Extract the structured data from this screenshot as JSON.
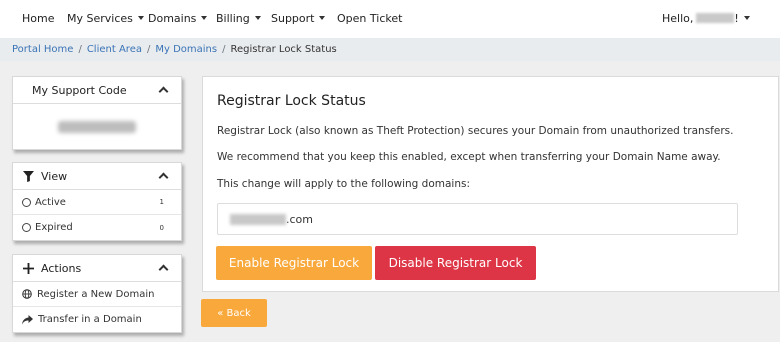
{
  "nav": {
    "items": [
      {
        "label": "Home"
      },
      {
        "label": "My Services"
      },
      {
        "label": "Domains"
      },
      {
        "label": "Billing"
      },
      {
        "label": "Support"
      },
      {
        "label": "Open Ticket"
      }
    ],
    "hello_prefix": "Hello,",
    "hello_suffix": "!"
  },
  "breadcrumb": {
    "items": [
      "Portal Home",
      "Client Area",
      "My Domains"
    ],
    "active": "Registrar Lock Status"
  },
  "sidebar": {
    "support_code": {
      "title": "My Support Code"
    },
    "view": {
      "title": "View",
      "icon": "filter-icon",
      "items": [
        {
          "label": "Active",
          "count": "1"
        },
        {
          "label": "Expired",
          "count": "0"
        }
      ]
    },
    "actions": {
      "title": "Actions",
      "icon": "plus-icon",
      "items": [
        {
          "label": "Register a New Domain",
          "icon": "globe-icon"
        },
        {
          "label": "Transfer in a Domain",
          "icon": "share-arrow-icon"
        }
      ]
    }
  },
  "main": {
    "title": "Registrar Lock Status",
    "description": "Registrar Lock (also known as Theft Protection) secures your Domain from unauthorized transfers.",
    "recommendation": "We recommend that you keep this enabled, except when transferring your Domain Name away.",
    "apply_note": "This change will apply to the following domains:",
    "domain_suffix": ".com",
    "enable_label": "Enable Registrar Lock",
    "disable_label": "Disable Registrar Lock",
    "back_label": "« Back"
  },
  "colors": {
    "warning": "#f9a93b",
    "danger": "#dd3545",
    "link": "#3a74b6"
  }
}
